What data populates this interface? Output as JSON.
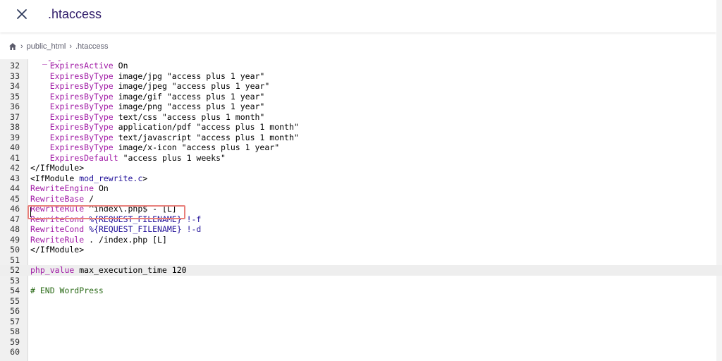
{
  "window": {
    "file_name": ".htaccess"
  },
  "breadcrumb": {
    "items": [
      "public_html",
      ".htaccess"
    ]
  },
  "editor": {
    "lines": [
      {
        "num": "32",
        "indent": "    ",
        "kw": "ExpiresActive",
        "rest": " On"
      },
      {
        "num": "33",
        "indent": "    ",
        "kw": "ExpiresByType",
        "rest": " image/jpg \"access plus 1 year\""
      },
      {
        "num": "34",
        "indent": "    ",
        "kw": "ExpiresByType",
        "rest": " image/jpeg \"access plus 1 year\""
      },
      {
        "num": "35",
        "indent": "    ",
        "kw": "ExpiresByType",
        "rest": " image/gif \"access plus 1 year\""
      },
      {
        "num": "36",
        "indent": "    ",
        "kw": "ExpiresByType",
        "rest": " image/png \"access plus 1 year\""
      },
      {
        "num": "37",
        "indent": "    ",
        "kw": "ExpiresByType",
        "rest": " text/css \"access plus 1 month\""
      },
      {
        "num": "38",
        "indent": "    ",
        "kw": "ExpiresByType",
        "rest": " application/pdf \"access plus 1 month\""
      },
      {
        "num": "39",
        "indent": "    ",
        "kw": "ExpiresByType",
        "rest": " text/javascript \"access plus 1 month\""
      },
      {
        "num": "40",
        "indent": "    ",
        "kw": "ExpiresByType",
        "rest": " image/x-icon \"access plus 1 year\""
      },
      {
        "num": "41",
        "indent": "    ",
        "kw": "ExpiresDefault",
        "rest": " \"access plus 1 weeks\""
      },
      {
        "num": "42",
        "indent": "",
        "kw": "",
        "rest": "</IfModule>"
      },
      {
        "num": "43",
        "indent": "",
        "kw": "",
        "rest": "<IfModule ",
        "str": "mod_rewrite.c",
        "rest2": ">"
      },
      {
        "num": "44",
        "indent": "",
        "kw": "RewriteEngine",
        "rest": " On"
      },
      {
        "num": "45",
        "indent": "",
        "kw": "RewriteBase",
        "rest": " /"
      },
      {
        "num": "46",
        "indent": "",
        "kw": "RewriteRule",
        "rest": " ^index\\.php$ - [L]"
      },
      {
        "num": "47",
        "indent": "",
        "kw": "RewriteCond",
        "rest": " ",
        "str": "%{REQUEST_FILENAME} !-f",
        "rest2": ""
      },
      {
        "num": "48",
        "indent": "",
        "kw": "RewriteCond",
        "rest": " ",
        "str": "%{REQUEST_FILENAME} !-d",
        "rest2": ""
      },
      {
        "num": "49",
        "indent": "",
        "kw": "RewriteRule",
        "rest": " . /index.php [L]"
      },
      {
        "num": "50",
        "indent": "",
        "kw": "",
        "rest": "</IfModule>"
      },
      {
        "num": "51",
        "indent": "",
        "kw": "",
        "rest": ""
      },
      {
        "num": "52",
        "indent": "",
        "kw": "php_value",
        "rest": " max_execution_time 120",
        "active": true
      },
      {
        "num": "53",
        "indent": "",
        "kw": "",
        "rest": ""
      },
      {
        "num": "54",
        "indent": "",
        "kw": "",
        "rest": "",
        "comment": "# END WordPress"
      },
      {
        "num": "55",
        "indent": "",
        "kw": "",
        "rest": ""
      },
      {
        "num": "56",
        "indent": "",
        "kw": "",
        "rest": ""
      },
      {
        "num": "57",
        "indent": "",
        "kw": "",
        "rest": ""
      },
      {
        "num": "58",
        "indent": "",
        "kw": "",
        "rest": ""
      },
      {
        "num": "59",
        "indent": "",
        "kw": "",
        "rest": ""
      },
      {
        "num": "60",
        "indent": "",
        "kw": "",
        "rest": ""
      }
    ]
  },
  "colors": {
    "keyword": "#a11ba6",
    "string": "#221199",
    "comment": "#2b6b18",
    "highlight_border": "#e8807b"
  }
}
